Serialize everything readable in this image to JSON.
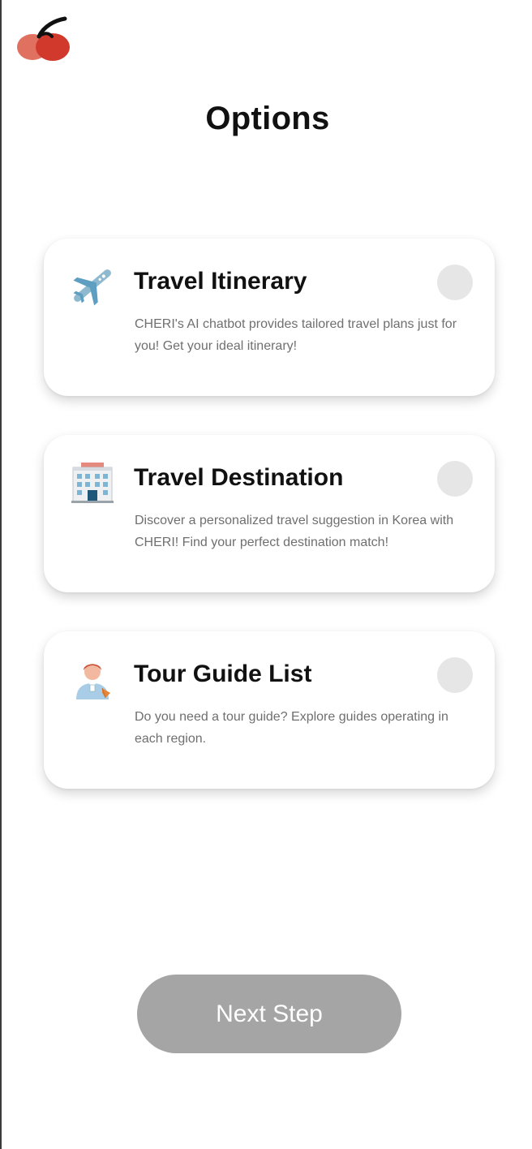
{
  "header": {
    "logo_icon": "cherry-logo-icon",
    "title": "Options"
  },
  "options": [
    {
      "icon": "airplane-icon",
      "title": "Travel Itinerary",
      "description": "CHERI's AI chatbot provides tailored travel plans just for you! Get your ideal itinerary!",
      "selected": false
    },
    {
      "icon": "building-icon",
      "title": "Travel Destination",
      "description": "Discover a personalized travel suggestion in Korea with CHERI! Find your perfect destination match!",
      "selected": false
    },
    {
      "icon": "tour-guide-icon",
      "title": "Tour Guide List",
      "description": "Do you need a tour guide? Explore guides operating in each region.",
      "selected": false
    }
  ],
  "footer": {
    "next_label": "Next Step"
  },
  "colors": {
    "cherry_red": "#d0392b",
    "radio_unselected": "#e6e6e6",
    "button_disabled": "#a5a5a5",
    "description_text": "#6f6f6f"
  }
}
